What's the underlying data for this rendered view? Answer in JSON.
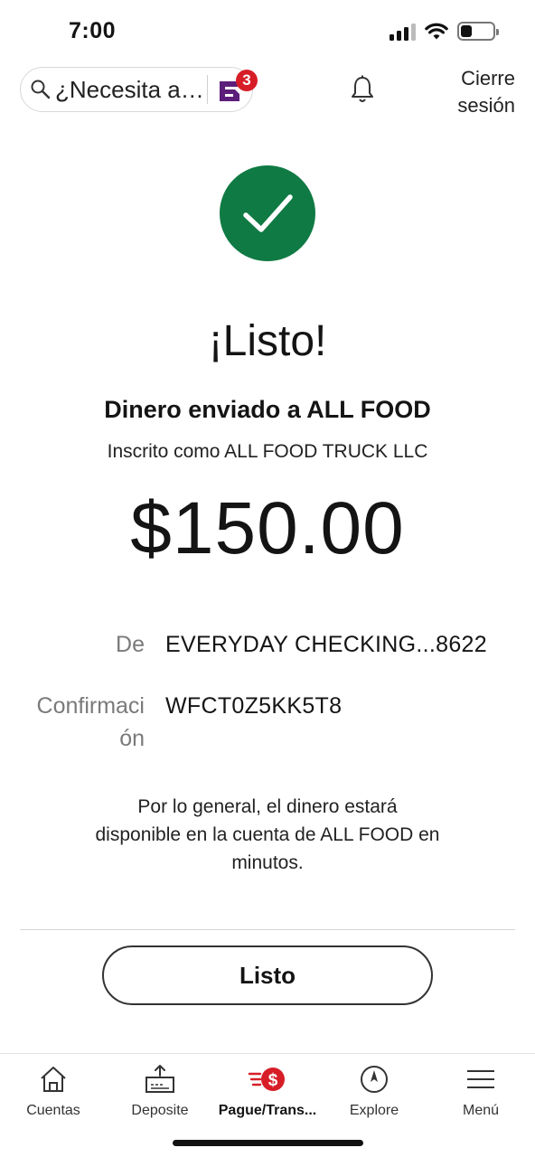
{
  "status_bar": {
    "time": "7:00",
    "battery_level": 0.35
  },
  "header": {
    "search_placeholder": "¿Necesita a…",
    "notifications_badge": "3",
    "logout_label": "Cierre sesión",
    "logout_line1": "Cierre",
    "logout_line2": "sesión"
  },
  "confirmation": {
    "title": "¡Listo!",
    "sent_to": "Dinero enviado a ALL FOOD",
    "enrolled_as": "Inscrito como ALL FOOD TRUCK LLC",
    "amount": "$150.00",
    "from_label": "De",
    "from_value": "EVERYDAY CHECKING...8622",
    "confirmation_label_line1": "Confirmaci",
    "confirmation_label_line2": "ón",
    "confirmation_value": "WFCT0Z5KK5T8",
    "note_line1": "Por lo general, el dinero estará",
    "note_line2": "disponible en la cuenta de ALL FOOD en",
    "note_line3": "minutos.",
    "done_button": "Listo"
  },
  "tabs": [
    {
      "label": "Cuentas",
      "icon": "home-icon"
    },
    {
      "label": "Deposite",
      "icon": "deposit-icon"
    },
    {
      "label": "Pague/Trans...",
      "icon": "pay-transfer-icon",
      "active": true
    },
    {
      "label": "Explore",
      "icon": "compass-icon"
    },
    {
      "label": "Menú",
      "icon": "menu-icon"
    }
  ],
  "colors": {
    "success_green": "#0f7a43",
    "brand_red": "#d71e28",
    "brand_purple": "#5c1f7a"
  }
}
